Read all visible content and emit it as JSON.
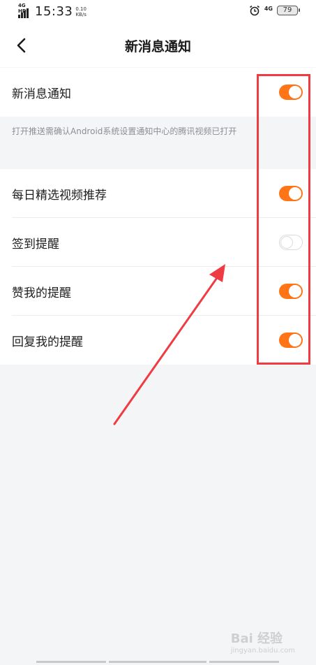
{
  "status_bar": {
    "network_left": "4G HD",
    "time": "15:33",
    "speed_value": "0.10",
    "speed_unit": "KB/s",
    "network_right": "4G",
    "battery": "79"
  },
  "header": {
    "title": "新消息通知"
  },
  "main_toggle": {
    "label": "新消息通知",
    "on": true
  },
  "hint_text": "打开推送需确认Android系统设置通知中心的腾讯视频已打开",
  "settings": [
    {
      "label": "每日精选视频推荐",
      "on": true
    },
    {
      "label": "签到提醒",
      "on": false
    },
    {
      "label": "赞我的提醒",
      "on": true
    },
    {
      "label": "回复我的提醒",
      "on": true
    }
  ],
  "colors": {
    "toggle_on": "#ff7417",
    "annotation_red": "#ef3b42"
  },
  "watermark": {
    "text": "Bai 经验",
    "sub": "jingyan.baidu.com"
  }
}
